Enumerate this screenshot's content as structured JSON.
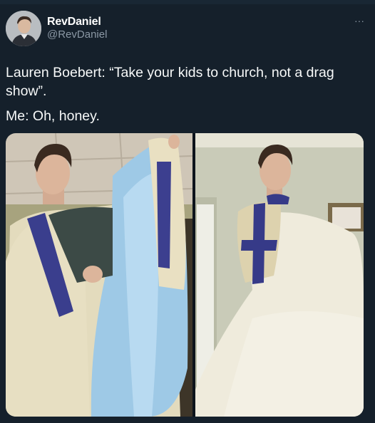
{
  "author": {
    "display_name": "RevDaniel",
    "handle": "@RevDaniel",
    "avatar_icon": "user-avatar"
  },
  "menu": {
    "icon": "more-horizontal-icon",
    "glyph": "···"
  },
  "tweet": {
    "line1": "Lauren Boebert: “Take your kids to church, not a drag show”.",
    "line2": "Me: Oh, honey."
  },
  "media": {
    "count": 2,
    "colors": {
      "background": "#15202b",
      "vestment": "#e6dfc4",
      "lining": "#9cc6e4",
      "stole": "#3b3f8c"
    }
  }
}
